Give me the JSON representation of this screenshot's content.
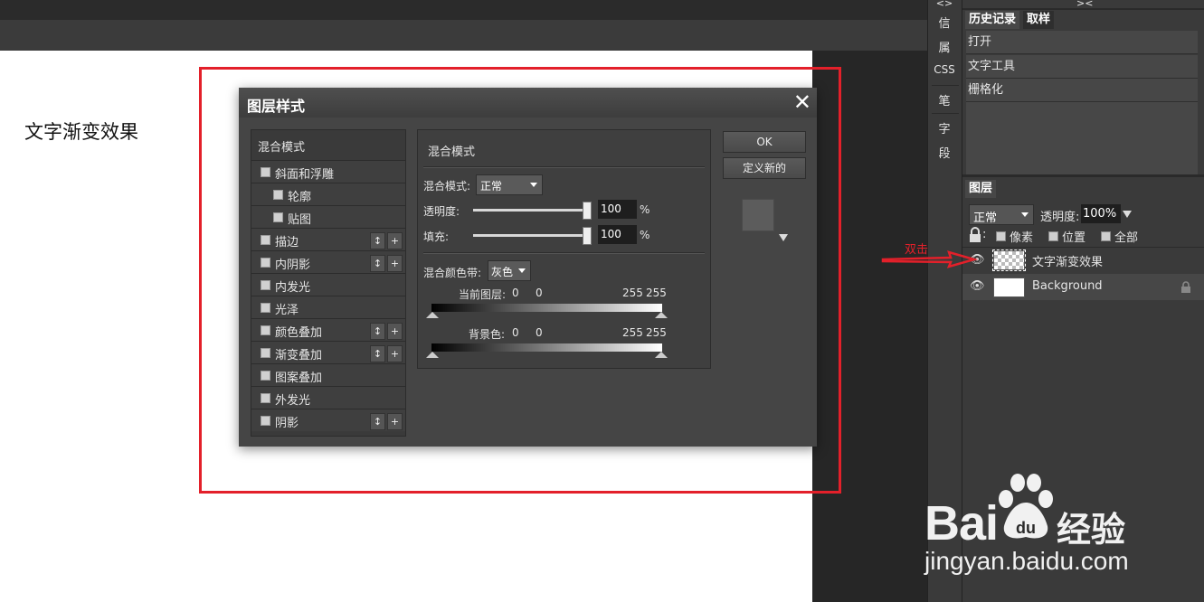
{
  "canvas": {
    "text": "文字渐变效果"
  },
  "dialog": {
    "title": "图层样式",
    "close_glyph": "✕",
    "style_list": [
      {
        "label": "混合模式",
        "checkbox": false,
        "indent": false,
        "buttons": false
      },
      {
        "label": "斜面和浮雕",
        "checkbox": true,
        "indent": false,
        "buttons": false
      },
      {
        "label": "轮廓",
        "checkbox": true,
        "indent": true,
        "buttons": false
      },
      {
        "label": "贴图",
        "checkbox": true,
        "indent": true,
        "buttons": false
      },
      {
        "label": "描边",
        "checkbox": true,
        "indent": false,
        "buttons": true
      },
      {
        "label": "内阴影",
        "checkbox": true,
        "indent": false,
        "buttons": true
      },
      {
        "label": "内发光",
        "checkbox": true,
        "indent": false,
        "buttons": false
      },
      {
        "label": "光泽",
        "checkbox": true,
        "indent": false,
        "buttons": false
      },
      {
        "label": "颜色叠加",
        "checkbox": true,
        "indent": false,
        "buttons": true
      },
      {
        "label": "渐变叠加",
        "checkbox": true,
        "indent": false,
        "buttons": true
      },
      {
        "label": "图案叠加",
        "checkbox": true,
        "indent": false,
        "buttons": false
      },
      {
        "label": "外发光",
        "checkbox": true,
        "indent": false,
        "buttons": false
      },
      {
        "label": "阴影",
        "checkbox": true,
        "indent": false,
        "buttons": true
      }
    ],
    "row_buttons": {
      "move": "↕",
      "add": "+"
    },
    "props": {
      "heading": "混合模式",
      "blend_mode_label": "混合模式:",
      "blend_mode_value": "正常",
      "opacity_label": "透明度:",
      "opacity_value": "100",
      "opacity_level": 1.0,
      "fill_label": "填充:",
      "fill_value": "100",
      "fill_level": 1.0,
      "percent": "%",
      "blend_band_label": "混合颜色带:",
      "blend_band_value": "灰色",
      "this_layer_label": "当前图层:",
      "this_layer_values": [
        "0",
        "0",
        "255",
        "255"
      ],
      "underlying_label": "背景色:",
      "underlying_values": [
        "0",
        "0",
        "255",
        "255"
      ]
    },
    "ok_label": "OK",
    "new_style_label": "定义新的"
  },
  "icon_column": {
    "collapse": "<>",
    "items": [
      "信",
      "属",
      "CSS",
      "笔",
      "字",
      "段"
    ]
  },
  "history": {
    "collapse": "><",
    "tabs": [
      "历史记录",
      "取样"
    ],
    "items": [
      "打开",
      "文字工具",
      "栅格化"
    ]
  },
  "layers": {
    "tab": "图层",
    "blend_mode": "正常",
    "opacity_label": "透明度:",
    "opacity_value": "100%",
    "lock_pixels": "像素",
    "lock_position": "位置",
    "lock_all": "全部",
    "items": [
      {
        "name": "文字渐变效果",
        "visible": true,
        "locked": false,
        "selected": true
      },
      {
        "name": "Background",
        "visible": true,
        "locked": true,
        "selected": false
      }
    ]
  },
  "annotation": {
    "text": "双击",
    "color": "#e3202a"
  },
  "watermark": {
    "brand": "Bai",
    "brand_suffix": "du",
    "product": "经验",
    "url": "jingyan.baidu.com"
  }
}
